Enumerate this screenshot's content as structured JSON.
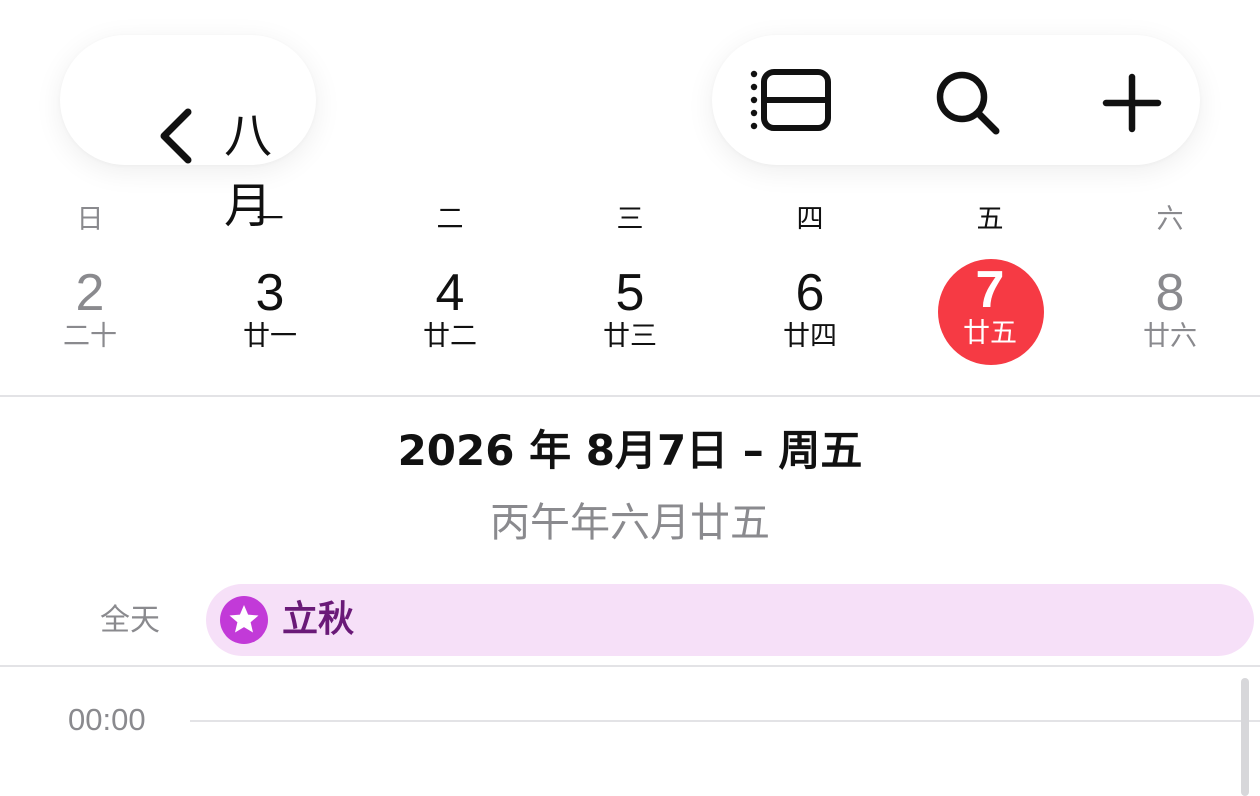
{
  "header": {
    "back_label": "八月",
    "icons": {
      "back": "chevron-left-icon",
      "view": "list-view-icon",
      "search": "search-icon",
      "add": "plus-icon"
    }
  },
  "week": [
    {
      "weekday": "日",
      "date": "2",
      "lunar": "二十",
      "weekend": true,
      "selected": false
    },
    {
      "weekday": "一",
      "date": "3",
      "lunar": "廿一",
      "weekend": false,
      "selected": false
    },
    {
      "weekday": "二",
      "date": "4",
      "lunar": "廿二",
      "weekend": false,
      "selected": false
    },
    {
      "weekday": "三",
      "date": "5",
      "lunar": "廿三",
      "weekend": false,
      "selected": false
    },
    {
      "weekday": "四",
      "date": "6",
      "lunar": "廿四",
      "weekend": false,
      "selected": false
    },
    {
      "weekday": "五",
      "date": "7",
      "lunar": "廿五",
      "weekend": false,
      "selected": true
    },
    {
      "weekday": "六",
      "date": "8",
      "lunar": "廿六",
      "weekend": true,
      "selected": false
    }
  ],
  "day_header": {
    "date_line": "2026 年 8月7日 – 周五",
    "lunar_line": "丙午年六月廿五"
  },
  "all_day": {
    "label": "全天",
    "event": {
      "title": "立秋",
      "icon": "star-icon"
    }
  },
  "timeline": {
    "first_hour": "00:00"
  },
  "colors": {
    "accent_red": "#f63a44",
    "event_bg": "#f6e0f8",
    "event_text": "#6a1a78",
    "event_icon": "#c23ad8",
    "secondary_text": "#8a8a8e",
    "divider": "#e3e3e6"
  }
}
